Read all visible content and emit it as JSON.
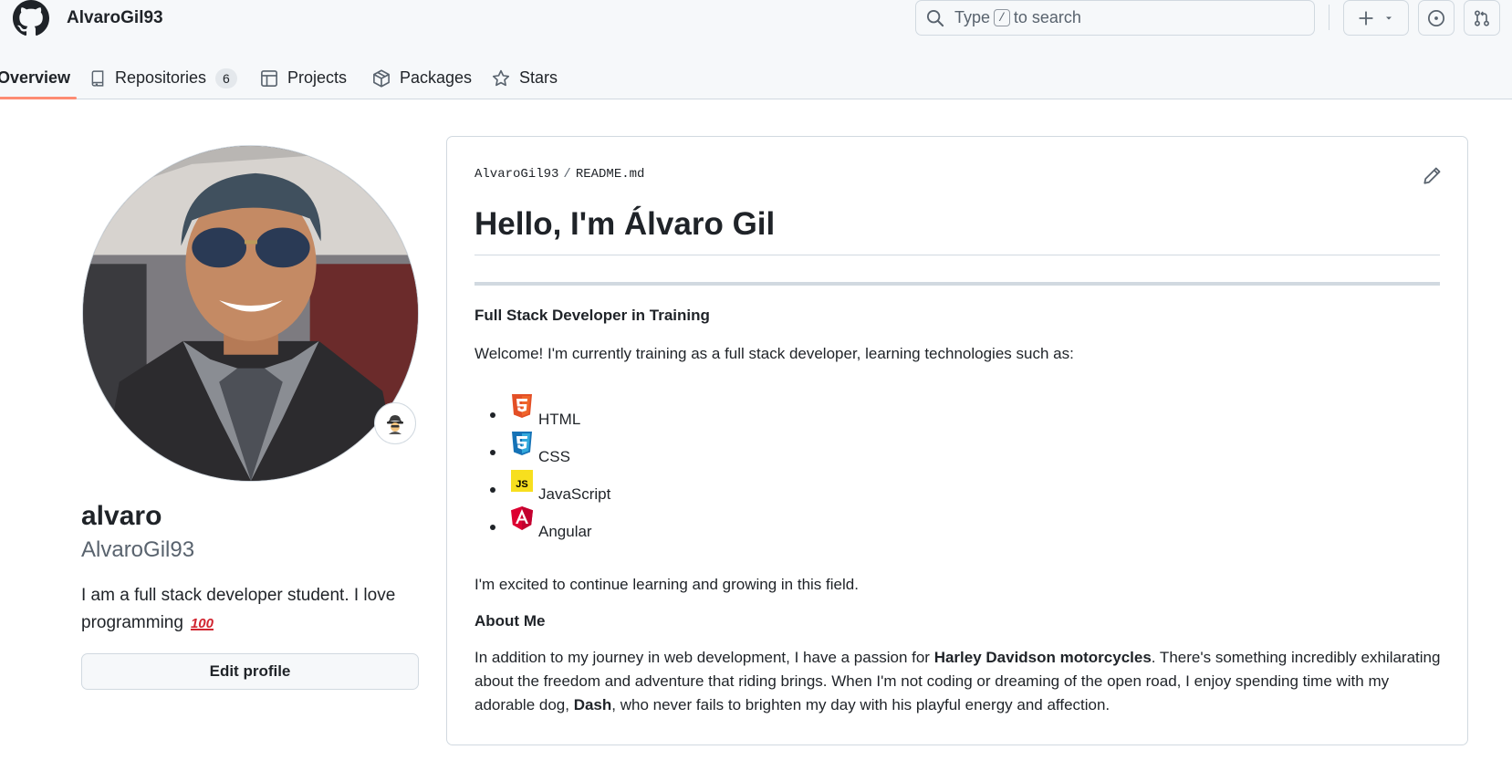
{
  "header": {
    "username": "AlvaroGil93",
    "search": {
      "prefix": "Type",
      "key": "/",
      "suffix": "to search"
    }
  },
  "tabs": [
    {
      "label": "Overview"
    },
    {
      "label": "Repositories",
      "count": "6"
    },
    {
      "label": "Projects"
    },
    {
      "label": "Packages"
    },
    {
      "label": "Stars"
    }
  ],
  "profile": {
    "display_name": "alvaro",
    "login": "AlvaroGil93",
    "bio": "I am a full stack developer student. I love programming",
    "bio_emoji": "100",
    "edit_button": "Edit profile"
  },
  "readme": {
    "owner": "AlvaroGil93",
    "file_base": "README",
    "file_ext": ".md",
    "title": "Hello, I'm Álvaro Gil",
    "subtitle": "Full Stack Developer in Training",
    "intro": "Welcome! I'm currently training as a full stack developer, learning technologies such as:",
    "technologies": [
      {
        "label": "HTML",
        "icon": "html5-icon",
        "color": "#e34f26"
      },
      {
        "label": "CSS",
        "icon": "css3-icon",
        "color": "#1572b6"
      },
      {
        "label": "JavaScript",
        "icon": "javascript-icon",
        "color": "#f7df1e"
      },
      {
        "label": "Angular",
        "icon": "angular-icon",
        "color": "#dd0031"
      }
    ],
    "closing": "I'm excited to continue learning and growing in this field.",
    "about_heading": "About Me",
    "about": {
      "part1": "In addition to my journey in web development, I have a passion for ",
      "bold1": "Harley Davidson motorcycles",
      "part2": ". There's something incredibly exhilarating about the freedom and adventure that riding brings. When I'm not coding or dreaming of the open road, I enjoy spending time with my adorable dog, ",
      "bold2": "Dash",
      "part3": ", who never fails to brighten my day with his playful energy and affection."
    }
  },
  "colors": {
    "tab_underline": "#fd8c73",
    "border": "#d1d9e0",
    "muted_text": "#59636e",
    "header_bg": "#f6f8fa"
  }
}
